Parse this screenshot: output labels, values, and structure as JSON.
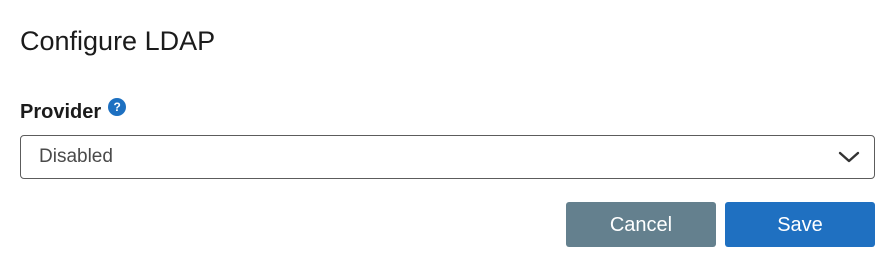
{
  "dialog": {
    "title": "Configure LDAP"
  },
  "provider": {
    "label": "Provider",
    "help_icon": "question-mark",
    "selected_value": "Disabled",
    "dropdown_icon": "chevron-down"
  },
  "actions": {
    "cancel_label": "Cancel",
    "save_label": "Save"
  },
  "colors": {
    "primary": "#1f70c1",
    "secondary": "#64808e",
    "help_icon": "#1d70c1"
  }
}
